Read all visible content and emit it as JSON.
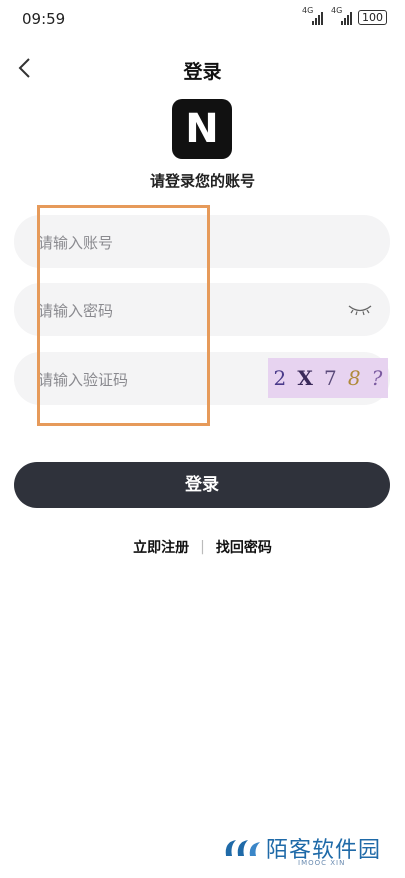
{
  "status_bar": {
    "time": "09:59",
    "signal1_label": "4G",
    "signal2_label": "4G",
    "battery": "100"
  },
  "header": {
    "title": "登录"
  },
  "app": {
    "logo_letter": "N",
    "subtitle": "请登录您的账号"
  },
  "form": {
    "account_placeholder": "请输入账号",
    "password_placeholder": "请输入密码",
    "captcha_placeholder": "请输入验证码",
    "captcha_chars": [
      "2",
      "X",
      "7",
      "8",
      "?"
    ]
  },
  "actions": {
    "login_label": "登录",
    "register_label": "立即注册",
    "forgot_label": "找回密码",
    "separator": "|"
  },
  "watermark": {
    "text": "陌客软件园",
    "sub": "IMOOC XIN"
  },
  "colors": {
    "highlight": "#e69a5a",
    "button": "#2f323b",
    "field_bg": "#f4f4f5",
    "captcha_bg": "#e7d3f0"
  }
}
